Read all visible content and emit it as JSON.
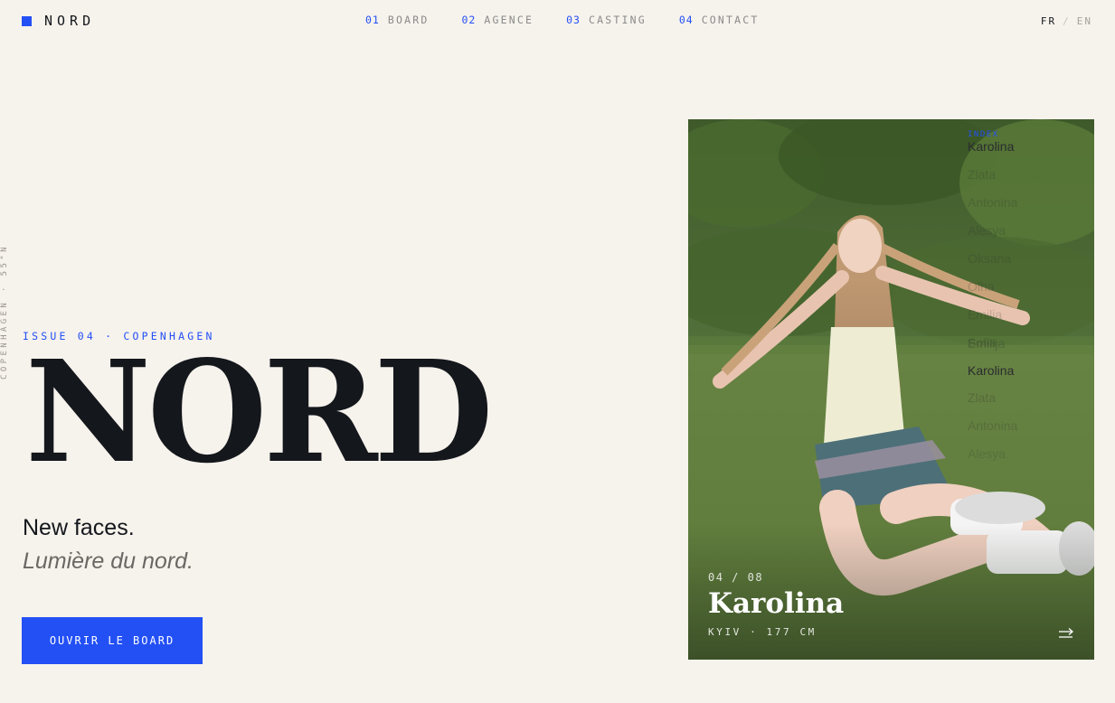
{
  "brand": {
    "name": "NORD",
    "accent": "#2350f5"
  },
  "nav": [
    {
      "num": "01",
      "label": "BOARD"
    },
    {
      "num": "02",
      "label": "AGENCE"
    },
    {
      "num": "03",
      "label": "CASTING"
    },
    {
      "num": "04",
      "label": "CONTACT"
    }
  ],
  "lang": {
    "active": "FR",
    "separator": "/",
    "inactive": "EN"
  },
  "side_text": "COPENHAGEN · 55°N",
  "hero": {
    "eyebrow": "ISSUE 04 · COPENHAGEN",
    "title": "NORD",
    "tagline_1": "New faces.",
    "tagline_2": "Lumière du nord.",
    "cta": "OUVRIR LE BOARD"
  },
  "card": {
    "index": "04 / 08",
    "name": "Karolina",
    "meta": "KYIV · 177 CM",
    "arrow_icon": "arrow-right-icon"
  },
  "index_overlay": {
    "label": "INDEX",
    "items": [
      "Karolina",
      "Zlata",
      "Antonina",
      "Alesya",
      "Oksana",
      "Olha",
      "Emilia",
      "Sofia",
      "Emilija",
      "Karolina",
      "Zlata",
      "Antonina",
      "Alesya"
    ]
  }
}
